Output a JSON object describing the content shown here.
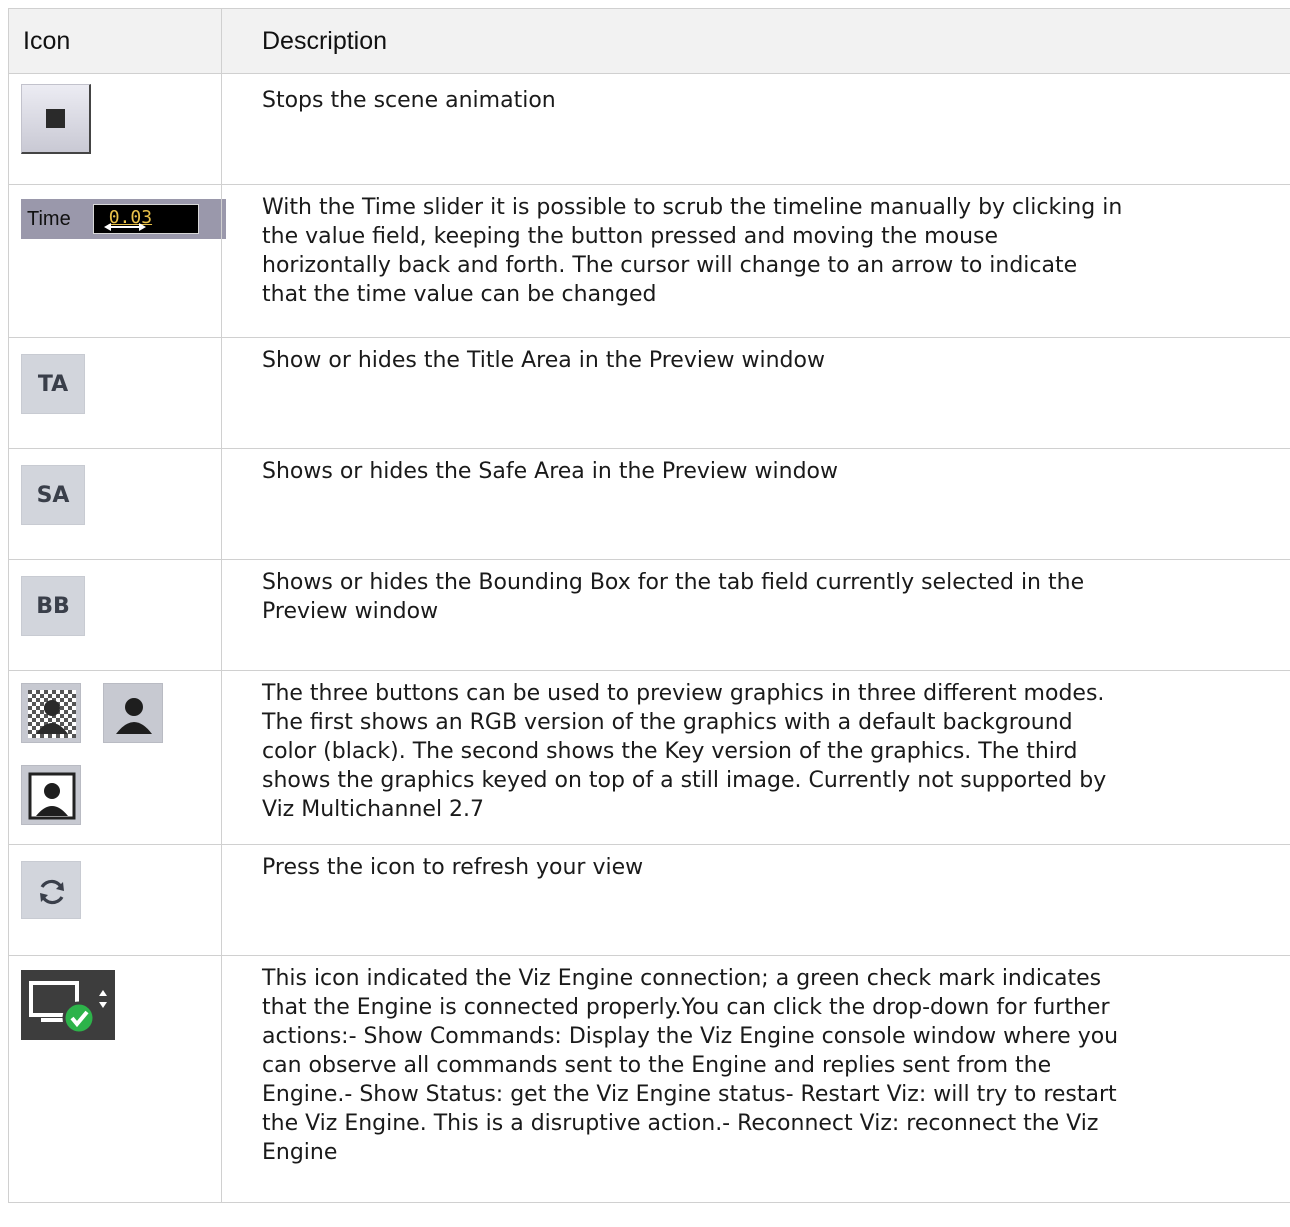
{
  "header": {
    "col_icon": "Icon",
    "col_description": "Description"
  },
  "rows": [
    {
      "icon": "stop-icon",
      "description": "Stops the scene animation"
    },
    {
      "icon": "time-slider",
      "time_label": "Time",
      "time_value": "0.03",
      "description": "With the Time slider it is possible to scrub the timeline manually by clicking in\nthe value field, keeping the button pressed and moving the mouse\nhorizontally back and forth. The cursor will change to an arrow to indicate\nthat the time value can be changed"
    },
    {
      "icon": "title-area-icon",
      "label": "TA",
      "description": "Show or hides the Title Area in the Preview window"
    },
    {
      "icon": "safe-area-icon",
      "label": "SA",
      "description": "Shows or hides the Safe Area in the Preview window"
    },
    {
      "icon": "bounding-box-icon",
      "label": "BB",
      "description": "Shows or hides the Bounding Box for the tab field currently selected in the\nPreview window"
    },
    {
      "icon": "preview-mode-icons",
      "description": "The three buttons can be used to preview graphics in three different modes.\nThe first shows an RGB version of the graphics with a default background\ncolor (black). The second shows the Key version of the graphics. The third\nshows the graphics keyed on top of a still image. Currently not supported by\nViz Multichannel 2.7"
    },
    {
      "icon": "refresh-icon",
      "description": "Press the icon to refresh your view"
    },
    {
      "icon": "viz-engine-connection-icon",
      "description": "This icon indicated the Viz Engine connection; a green check mark indicates\nthat the Engine is connected properly.You can click the drop-down for further\nactions:- Show Commands: Display the Viz Engine console window where you\ncan observe all commands sent to the Engine and replies sent from the\nEngine.- Show Status: get the Viz Engine status- Restart Viz: will try to restart\nthe Viz Engine. This is a disruptive action.- Reconnect Viz: reconnect the Viz\nEngine"
    }
  ],
  "colors": {
    "header_bg": "#f2f2f2",
    "border": "#d0d0d0",
    "check_green": "#2db34a"
  }
}
